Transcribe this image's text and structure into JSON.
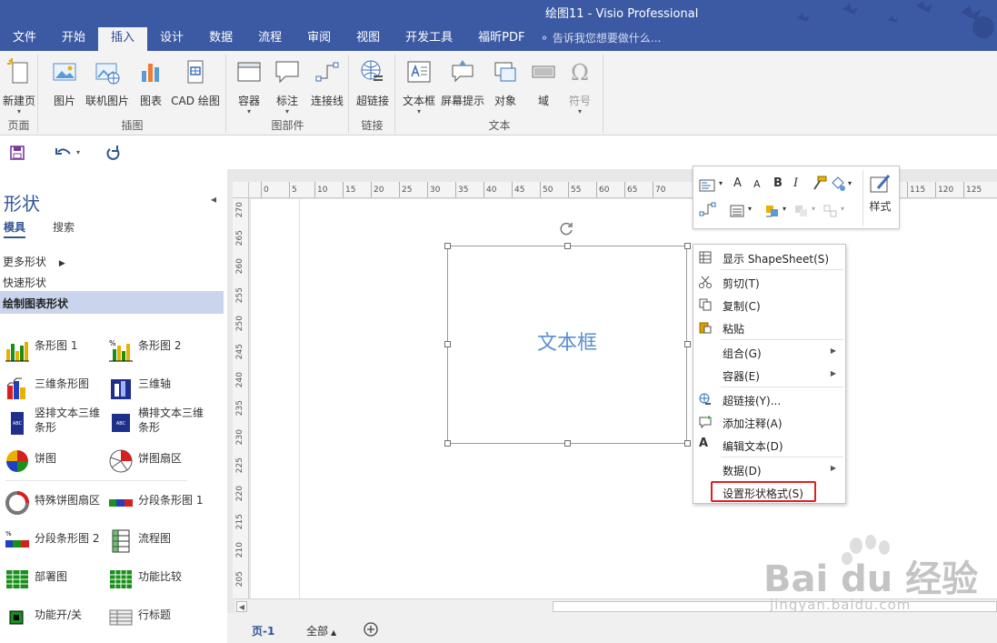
{
  "window": {
    "title": "绘图11 - Visio Professional"
  },
  "tabs": [
    {
      "label": "文件"
    },
    {
      "label": "开始"
    },
    {
      "label": "插入"
    },
    {
      "label": "设计"
    },
    {
      "label": "数据"
    },
    {
      "label": "流程"
    },
    {
      "label": "审阅"
    },
    {
      "label": "视图"
    },
    {
      "label": "开发工具"
    },
    {
      "label": "福昕PDF"
    }
  ],
  "tell_me": {
    "text": "告诉我您想要做什么..."
  },
  "ribbon": {
    "groups": {
      "pages": "页面",
      "illustrations": "插图",
      "diagram_parts": "图部件",
      "links": "链接",
      "text": "文本"
    },
    "buttons": {
      "new_page": "新建页",
      "picture": "图片",
      "online_picture": "联机图片",
      "chart": "图表",
      "cad": "CAD 绘图",
      "container": "容器",
      "callout": "标注",
      "connector": "连接线",
      "hyperlink": "超链接",
      "textbox": "文本框",
      "screentip": "屏幕提示",
      "object": "对象",
      "field": "域",
      "symbol": "符号"
    }
  },
  "shapes_pane": {
    "title": "形状",
    "tab_stencils": "模具",
    "tab_search": "搜索",
    "more_shapes": "更多形状",
    "quick_shapes": "快速形状",
    "selected_stencil": "绘制图表形状",
    "shapes": [
      {
        "label": "条形图 1"
      },
      {
        "label": "条形图 2"
      },
      {
        "label": "三维条形图"
      },
      {
        "label": "三维轴"
      },
      {
        "label": "竖排文本三维条形"
      },
      {
        "label": "横排文本三维条形"
      },
      {
        "label": "饼图"
      },
      {
        "label": "饼图扇区"
      },
      {
        "label": "特殊饼图扇区"
      },
      {
        "label": "分段条形图 1"
      },
      {
        "label": "分段条形图 2"
      },
      {
        "label": "流程图"
      },
      {
        "label": "部署图"
      },
      {
        "label": "功能比较"
      },
      {
        "label": "功能开/关"
      },
      {
        "label": "行标题"
      }
    ]
  },
  "ruler": {
    "top": [
      "0",
      "5",
      "10",
      "15",
      "20",
      "25",
      "30",
      "35",
      "40",
      "45",
      "50",
      "55",
      "60",
      "65",
      "70",
      "115",
      "120",
      "125"
    ],
    "left": [
      "270",
      "265",
      "260",
      "255",
      "250",
      "245",
      "240",
      "235",
      "230",
      "225",
      "220",
      "215",
      "210",
      "205"
    ]
  },
  "canvas": {
    "textbox_text": "文本框"
  },
  "mini_toolbar": {
    "grow_font": "A",
    "shrink_font": "A",
    "bold": "B",
    "italic": "I",
    "style_label": "样式"
  },
  "context_menu": [
    {
      "label": "显示 ShapeSheet(S)"
    },
    {
      "label": "剪切(T)"
    },
    {
      "label": "复制(C)"
    },
    {
      "label": "粘贴"
    },
    {
      "label": "组合(G)"
    },
    {
      "label": "容器(E)"
    },
    {
      "label": "超链接(Y)..."
    },
    {
      "label": "添加注释(A)"
    },
    {
      "label": "编辑文本(D)"
    },
    {
      "label": "数据(D)"
    },
    {
      "label": "设置形状格式(S)"
    }
  ],
  "page_tabs": {
    "current": "页-1",
    "all": "全部"
  },
  "watermark": {
    "brand": "Bai du 经验",
    "url": "jingyan.baidu.com"
  },
  "colors": {
    "titlebar": "#3c5aa4",
    "accent": "#2f5597",
    "highlight_box": "#e02020",
    "textbox_text": "#5b8fd0"
  }
}
